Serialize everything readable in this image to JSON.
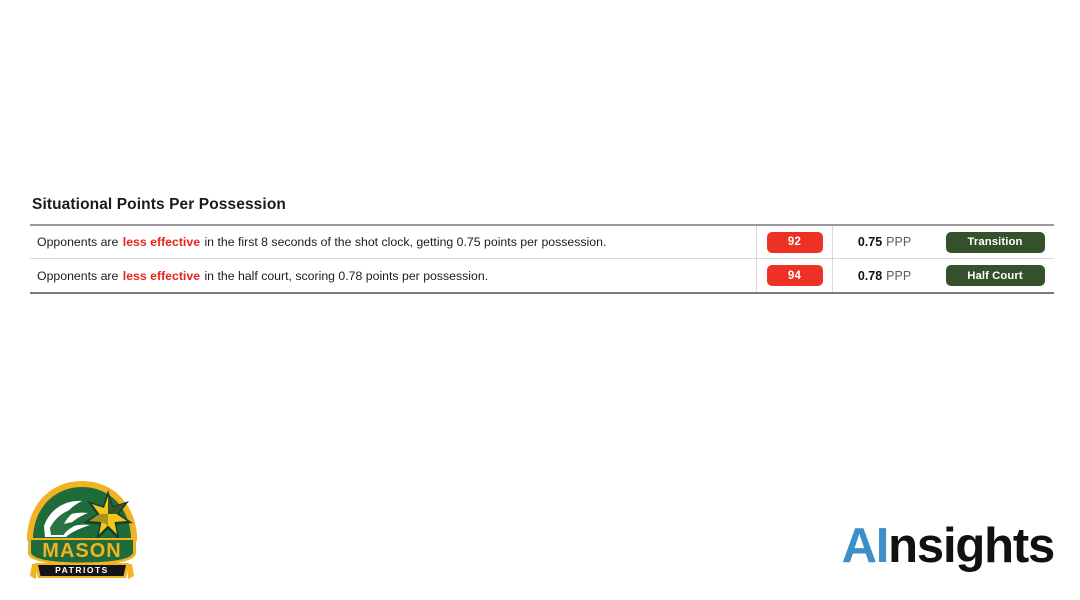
{
  "section": {
    "title": "Situational Points Per Possession",
    "rows": [
      {
        "desc_before": "Opponents are",
        "desc_highlight": "less effective",
        "desc_after": "in the first 8 seconds of the shot clock, getting 0.75 points per possession.",
        "rank": "92",
        "value": "0.75",
        "unit": "PPP",
        "tag": "Transition"
      },
      {
        "desc_before": "Opponents are",
        "desc_highlight": "less effective",
        "desc_after": "in the half court, scoring 0.78 points per possession.",
        "rank": "94",
        "value": "0.78",
        "unit": "PPP",
        "tag": "Half Court"
      }
    ]
  },
  "team_logo": {
    "name": "mason-patriots-logo",
    "wordmark": "MASON",
    "banner": "PATRIOTS",
    "colors": {
      "green": "#1f6b3b",
      "dark_green": "#14402a",
      "gold": "#f0b323",
      "star_gold": "#f5c518",
      "black": "#141414",
      "white": "#ffffff"
    }
  },
  "brand": {
    "prefix": "AI",
    "suffix": "nsights",
    "prefix_color": "#3e8fc8",
    "suffix_color": "#111111"
  },
  "theme": {
    "background": "#ffffff",
    "rank_badge_bg": "#ed3124",
    "tag_pill_bg": "#34512c",
    "highlight_text": "#e8251c",
    "rule_top": "#9a9a9a",
    "rule_bottom": "#7b7b7b",
    "rule_inner": "#d8d8d8"
  }
}
